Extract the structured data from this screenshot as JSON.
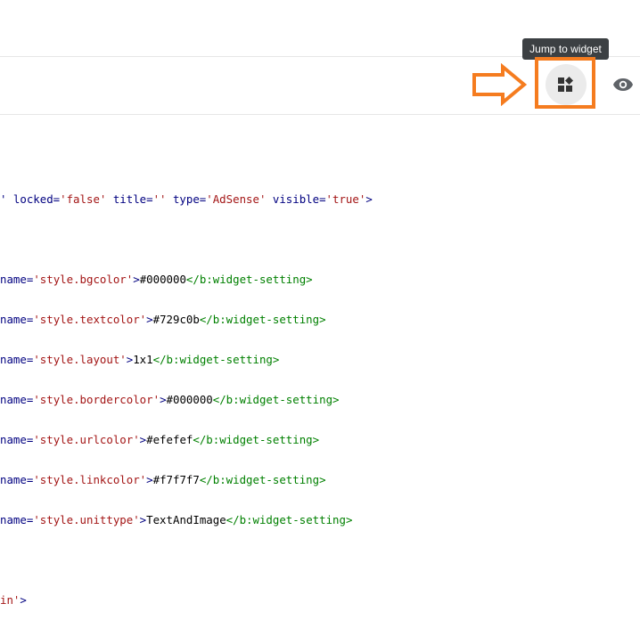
{
  "tooltip": {
    "text": "Jump to widget"
  },
  "toolbar": {
    "jump_icon": "widgets-icon",
    "preview_icon": "eye-icon"
  },
  "colors": {
    "highlight": "#f57c1f",
    "tooltip_bg": "#3c4043"
  },
  "code": {
    "line1": {
      "a": "' locked=",
      "b": "'false'",
      "c": " title=",
      "d": "''",
      "e": " type=",
      "f": "'AdSense'",
      "g": " visible=",
      "h": "'true'",
      "i": ">"
    },
    "settings": [
      {
        "pre": "name=",
        "name": "'style.bgcolor'",
        "gt": ">",
        "value": "#000000",
        "close": "</b:widget-setting>"
      },
      {
        "pre": "name=",
        "name": "'style.textcolor'",
        "gt": ">",
        "value": "#729c0b",
        "close": "</b:widget-setting>"
      },
      {
        "pre": "name=",
        "name": "'style.layout'",
        "gt": ">",
        "value": "1x1",
        "close": "</b:widget-setting>"
      },
      {
        "pre": "name=",
        "name": "'style.bordercolor'",
        "gt": ">",
        "value": "#000000",
        "close": "</b:widget-setting>"
      },
      {
        "pre": "name=",
        "name": "'style.urlcolor'",
        "gt": ">",
        "value": "#efefef",
        "close": "</b:widget-setting>"
      },
      {
        "pre": "name=",
        "name": "'style.linkcolor'",
        "gt": ">",
        "value": "#f7f7f7",
        "close": "</b:widget-setting>"
      },
      {
        "pre": "name=",
        "name": "'style.unittype'",
        "gt": ">",
        "value": "TextAndImage",
        "close": "</b:widget-setting>"
      }
    ],
    "last": {
      "a": "in'",
      "b": ">"
    }
  }
}
